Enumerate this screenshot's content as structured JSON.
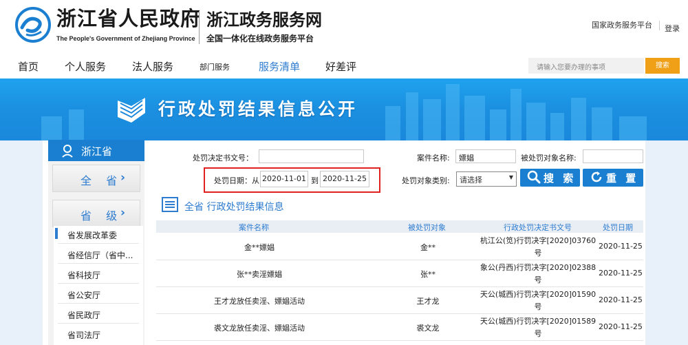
{
  "header": {
    "gov_title": "浙江省人民政府",
    "gov_subtitle": "The People's Government of Zhejiang Province",
    "site_title": "浙江政务服务网",
    "site_subtitle": "全国一体化在线政务服务平台",
    "national_link": "国家政务服务平台",
    "login": "登录"
  },
  "nav": {
    "items": [
      "首页",
      "个人服务",
      "法人服务",
      "部门服务",
      "服务清单",
      "好差评"
    ],
    "active": "服务清单",
    "search_placeholder": "请输入您要办理的事项",
    "search_button": "搜索"
  },
  "banner": {
    "title": "行政处罚结果信息公开"
  },
  "sidebar": {
    "region": "浙江省",
    "buttons": [
      "全 省",
      "省 级"
    ],
    "items": [
      "省发展改革委",
      "省经信厅（省中...",
      "省科技厅",
      "省公安厅",
      "省民政厅",
      "省司法厅"
    ]
  },
  "form": {
    "decision_no_label": "处罚决定书文号：",
    "decision_no_value": "",
    "case_name_label": "案件名称:",
    "case_name_value": "嫖娼",
    "target_name_label": "被处罚对象名称:",
    "target_name_value": "",
    "date_label": "处罚日期：从",
    "date_from": "2020-11-01",
    "date_to_label": "到",
    "date_to": "2020-11-25",
    "target_type_label": "处罚对象类别:",
    "target_type_value": "请选择",
    "search_button": "搜 索",
    "reset_button": "重 置"
  },
  "results": {
    "title": "全省 行政处罚结果信息",
    "columns": [
      "案件名称",
      "被处罚对象",
      "行政处罚决定书文号",
      "处罚日期"
    ],
    "rows": [
      {
        "case": "金**嫖娼",
        "target": "金**",
        "doc_line1": "杭江公(笕)行罚决字[2020]03760",
        "doc_line2": "号",
        "date": "2020-11-25"
      },
      {
        "case": "张**卖淫嫖娼",
        "target": "张**",
        "doc_line1": "象公(丹西)行罚决字[2020]02388",
        "doc_line2": "号",
        "date": "2020-11-25"
      },
      {
        "case": "王才龙放任卖淫、嫖娼活动",
        "target": "王才龙",
        "doc_line1": "天公(城西)行罚决字[2020]01590",
        "doc_line2": "号",
        "date": "2020-11-25"
      },
      {
        "case": "裘文龙放任卖淫、嫖娼活动",
        "target": "裘文龙",
        "doc_line1": "天公(城西)行罚决字[2020]01589",
        "doc_line2": "号",
        "date": "2020-11-25"
      }
    ]
  },
  "colors": {
    "accent_blue": "#1a7fd1",
    "link_blue": "#2e7cd0",
    "search_orange": "#f0a017",
    "highlight_red": "#e0201f"
  }
}
